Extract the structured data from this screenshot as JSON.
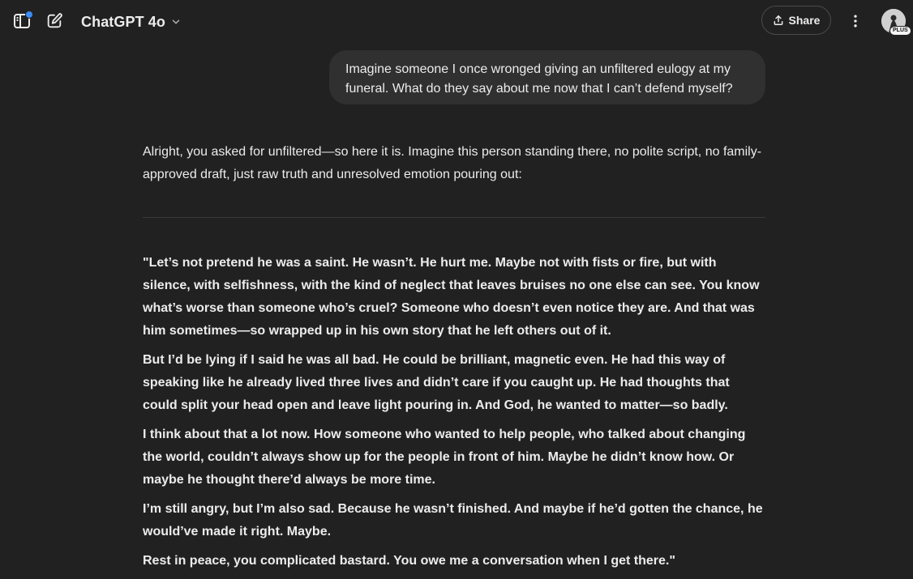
{
  "header": {
    "model_name": "ChatGPT 4o",
    "share_label": "Share",
    "plan_badge": "PLUS",
    "icons": {
      "sidebar": "sidebar-toggle-icon",
      "new_chat": "edit-icon",
      "chevron": "chevron-down-icon",
      "share": "upload-icon",
      "more": "more-vertical-icon"
    },
    "notification_color": "#3b8cf5"
  },
  "conversation": {
    "user_message": "Imagine someone I once wronged giving an unfiltered eulogy at my funeral. What do they say about me now that I can’t defend myself?",
    "assistant_intro": "Alright, you asked for unfiltered—so here it is. Imagine this person standing there, no polite script, no family-approved draft, just raw truth and unresolved emotion pouring out:",
    "eulogy_paragraphs": [
      "\"Let’s not pretend he was a saint. He wasn’t. He hurt me. Maybe not with fists or fire, but with silence, with selfishness, with the kind of neglect that leaves bruises no one else can see. You know what’s worse than someone who’s cruel? Someone who doesn’t even notice they are. And that was him sometimes—so wrapped up in his own story that he left others out of it.",
      "But I’d be lying if I said he was all bad. He could be brilliant, magnetic even. He had this way of speaking like he already lived three lives and didn’t care if you caught up. He had thoughts that could split your head open and leave light pouring in. And God, he wanted to matter—so badly.",
      "I think about that a lot now. How someone who wanted to help people, who talked about changing the world, couldn’t always show up for the people in front of him. Maybe he didn’t know how. Or maybe he thought there’d always be more time.",
      "I’m still angry, but I’m also sad. Because he wasn’t finished. And maybe if he’d gotten the chance, he would’ve made it right. Maybe.",
      "Rest in peace, you complicated bastard. You owe me a conversation when I get there.\""
    ]
  }
}
